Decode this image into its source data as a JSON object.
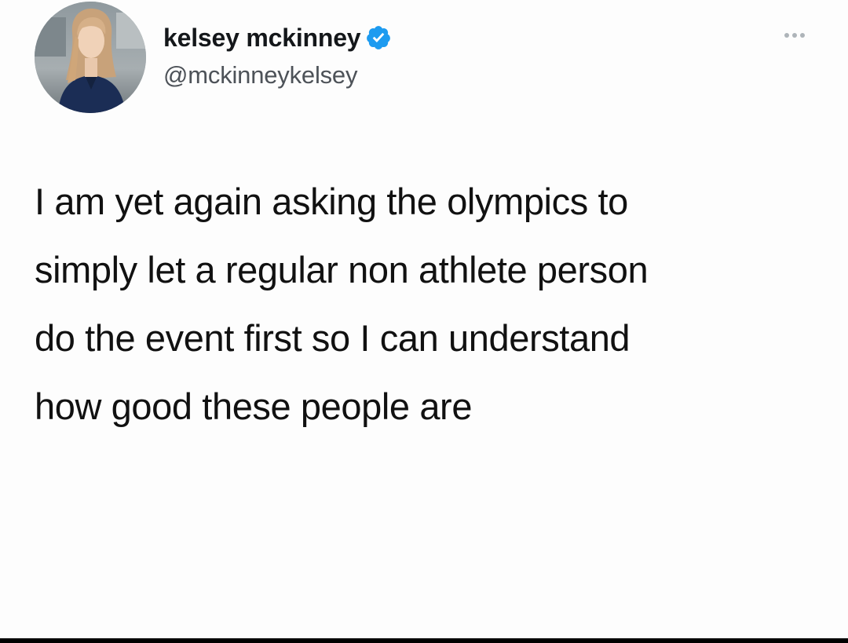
{
  "author": {
    "display_name": "kelsey mckinney",
    "handle": "@mckinneykelsey",
    "verified": true,
    "avatar_icon": "profile-photo"
  },
  "tweet": {
    "lines": [
      "I am yet again asking the olympics to",
      "simply let a regular non athlete person",
      "do the event first so I can understand",
      "how good these people are"
    ]
  },
  "icons": {
    "more": "more-horizontal-icon",
    "verified": "verified-badge-icon"
  },
  "colors": {
    "verified_blue": "#1d9bf0",
    "text": "#111111",
    "handle": "#4d5258",
    "more_dots": "#aeb4b9"
  }
}
